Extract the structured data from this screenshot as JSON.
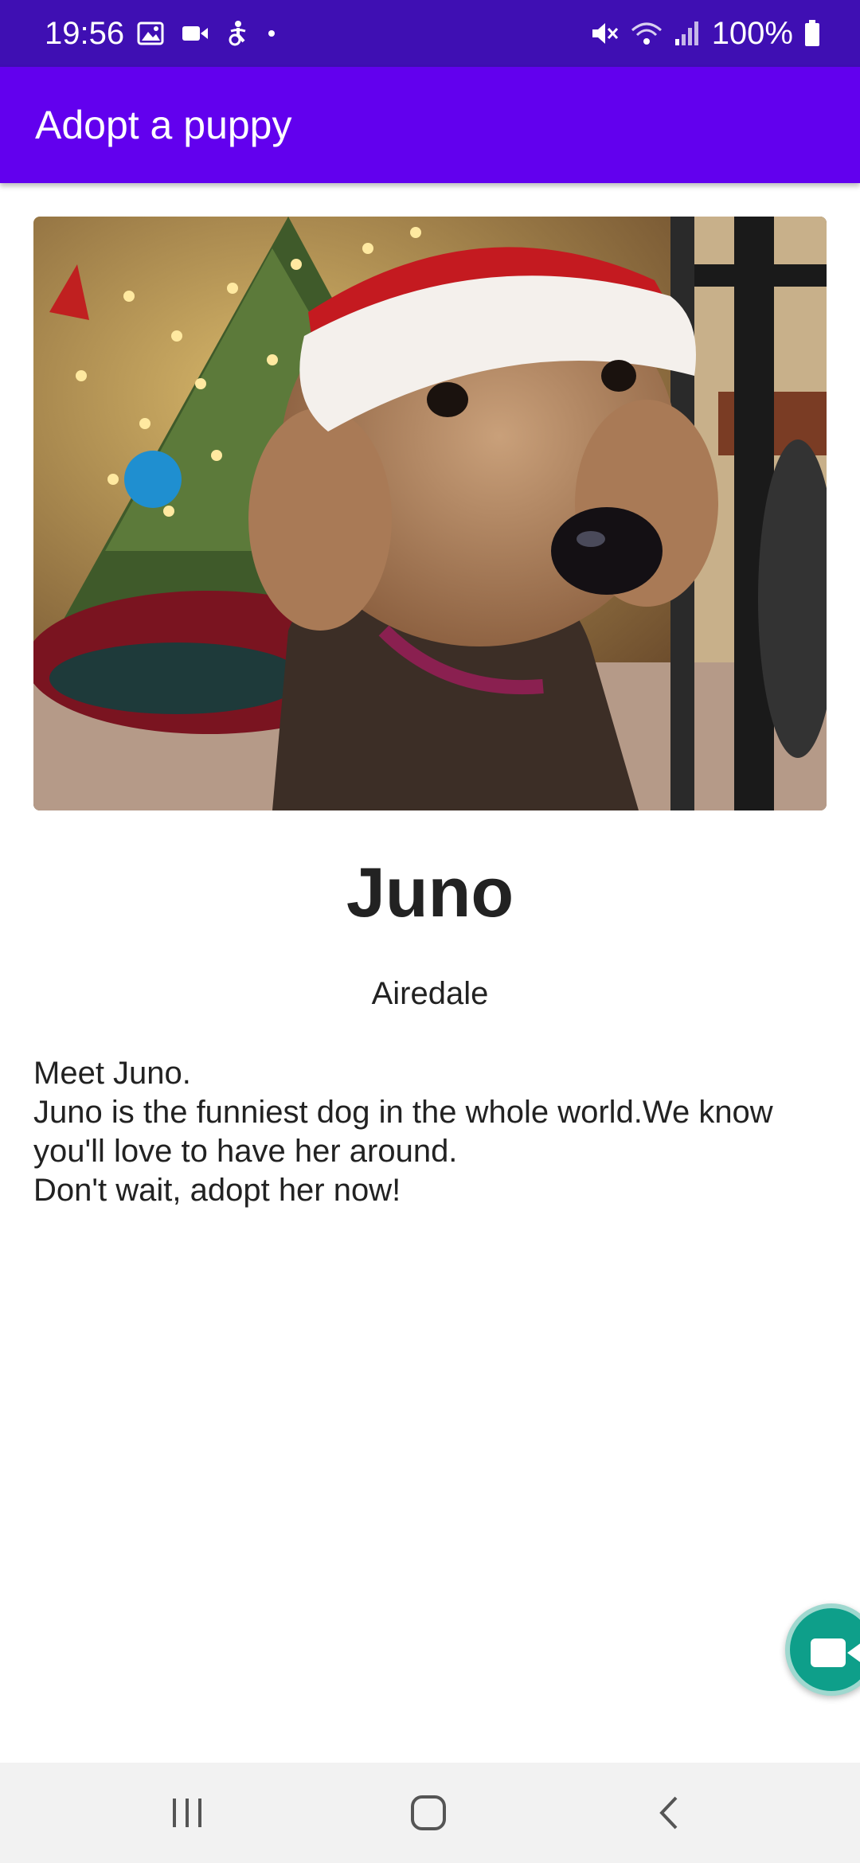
{
  "status_bar": {
    "time": "19:56",
    "battery": "100%",
    "icons_left": [
      "gallery-icon",
      "video-camera-icon",
      "accessibility-icon",
      "dot-icon"
    ],
    "icons_right": [
      "mute-icon",
      "wifi-icon",
      "signal-icon",
      "battery-icon"
    ],
    "background": "#3f0fb3"
  },
  "app_bar": {
    "title": "Adopt a puppy",
    "background": "#6200ee"
  },
  "puppy": {
    "image": "dog-photo-christmas-hat",
    "name": "Juno",
    "breed": "Airedale",
    "description_lines": [
      "Meet Juno.",
      "Juno is the funniest dog in the whole world.We know",
      "you'll love to have her around.",
      "Don't wait, adopt her now!"
    ]
  },
  "fab": {
    "icon": "video-camera-icon",
    "color": "#0e9f8a"
  },
  "nav_bar": {
    "buttons": [
      "recents-icon",
      "home-icon",
      "back-icon"
    ]
  }
}
